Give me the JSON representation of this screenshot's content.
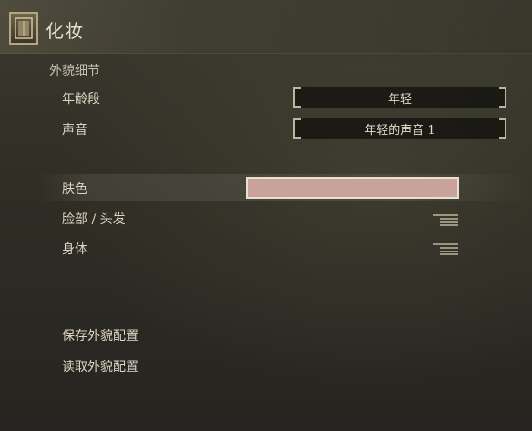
{
  "window": {
    "title": "化妆",
    "title_icon": "makeup-mirror-icon"
  },
  "appearance": {
    "section_title": "外貌细节",
    "age_group": {
      "label": "年龄段",
      "value": "年轻"
    },
    "voice": {
      "label": "声音",
      "value": "年轻的声音 1"
    }
  },
  "skin": {
    "label": "肤色",
    "swatch_color": "#c9a39b"
  },
  "face_hair": {
    "label": "脸部 / 头发",
    "icon": "menu-lines-icon"
  },
  "body": {
    "label": "身体",
    "icon": "menu-lines-icon"
  },
  "bottom": {
    "save_label": "保存外貌配置",
    "load_label": "读取外貌配置"
  }
}
